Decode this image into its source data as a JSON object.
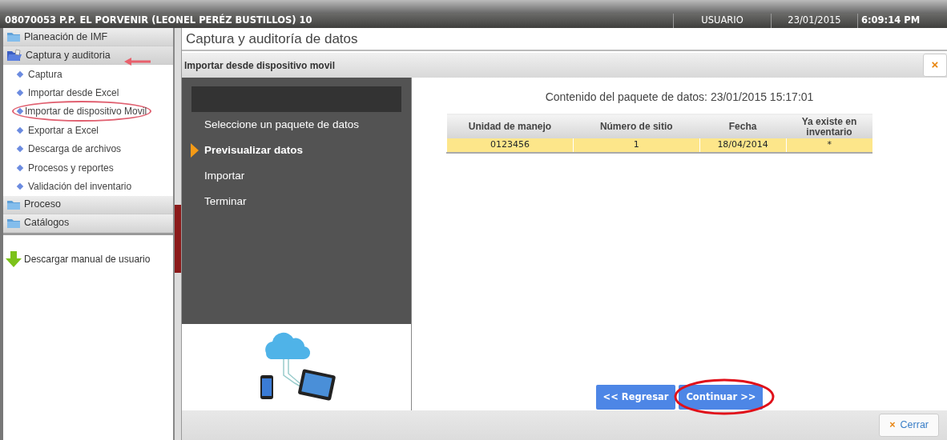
{
  "title_bar": {
    "title": "08070053 P.P. EL PORVENIR (LEONEL PERÉZ BUSTILLOS) 10",
    "user": "USUARIO",
    "date": "23/01/2015",
    "time": "6:09:14 PM"
  },
  "sidebar": {
    "sections": [
      {
        "label": "Planeación de IMF",
        "expanded": false
      },
      {
        "label": "Captura y auditoria",
        "expanded": true,
        "children": [
          {
            "label": "Captura"
          },
          {
            "label": "Importar desde Excel"
          },
          {
            "label": "Importar de dispositivo Movil"
          },
          {
            "label": "Exportar a Excel"
          },
          {
            "label": "Descarga de archivos"
          },
          {
            "label": "Procesos y reportes"
          },
          {
            "label": "Validación del inventario"
          }
        ]
      },
      {
        "label": "Proceso",
        "expanded": false
      },
      {
        "label": "Catálogos",
        "expanded": false
      }
    ],
    "download_link": "Descargar manual de usuario"
  },
  "page_title": "Captura y auditoría de datos",
  "dialog": {
    "title": "Importar desde dispositivo movil",
    "close": "×",
    "steps": [
      {
        "label": "Seleccione un paquete de datos",
        "selected": false
      },
      {
        "label": "Previsualizar datos",
        "selected": true
      },
      {
        "label": "Importar",
        "selected": false
      },
      {
        "label": "Terminar",
        "selected": false
      }
    ],
    "content_title": "Contenido del paquete de datos: 23/01/2015 15:17:01",
    "table": {
      "columns": [
        "Unidad de manejo",
        "Número de sitio",
        "Fecha",
        "Ya existe en inventario"
      ],
      "rows": [
        {
          "cells": [
            "0123456",
            "1",
            "18/04/2014",
            "*"
          ],
          "selected": true
        }
      ]
    },
    "buttons": [
      "<< Regresar",
      "Continuar >>"
    ],
    "footer_button": {
      "icon": "×",
      "label": "Cerrar"
    }
  }
}
